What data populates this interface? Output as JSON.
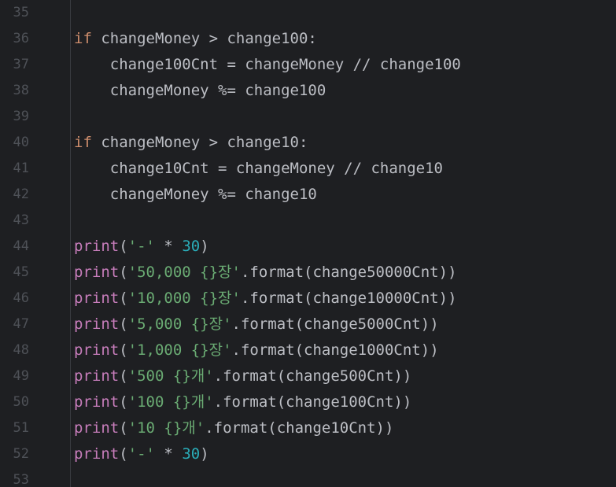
{
  "colors": {
    "background": "#1e1f22",
    "line_number": "#4e5157",
    "keyword": "#cf8e6d",
    "builtin_function": "#c77dbb",
    "string": "#6aab73",
    "number": "#2aacb8",
    "text": "#bcbec4"
  },
  "lines": [
    {
      "number": "35",
      "tokens": []
    },
    {
      "number": "36",
      "tokens": [
        {
          "t": "kw",
          "v": "if"
        },
        {
          "t": "plain",
          "v": " changeMoney > change100:"
        }
      ]
    },
    {
      "number": "37",
      "tokens": [
        {
          "t": "plain",
          "v": "    change100Cnt = changeMoney // change100"
        }
      ]
    },
    {
      "number": "38",
      "tokens": [
        {
          "t": "plain",
          "v": "    changeMoney %= change100"
        }
      ]
    },
    {
      "number": "39",
      "tokens": []
    },
    {
      "number": "40",
      "tokens": [
        {
          "t": "kw",
          "v": "if"
        },
        {
          "t": "plain",
          "v": " changeMoney > change10:"
        }
      ]
    },
    {
      "number": "41",
      "tokens": [
        {
          "t": "plain",
          "v": "    change10Cnt = changeMoney // change10"
        }
      ]
    },
    {
      "number": "42",
      "tokens": [
        {
          "t": "plain",
          "v": "    changeMoney %= change10"
        }
      ]
    },
    {
      "number": "43",
      "tokens": []
    },
    {
      "number": "44",
      "tokens": [
        {
          "t": "fn",
          "v": "print"
        },
        {
          "t": "plain",
          "v": "("
        },
        {
          "t": "str",
          "v": "'-'"
        },
        {
          "t": "plain",
          "v": " * "
        },
        {
          "t": "num",
          "v": "30"
        },
        {
          "t": "plain",
          "v": ")"
        }
      ]
    },
    {
      "number": "45",
      "tokens": [
        {
          "t": "fn",
          "v": "print"
        },
        {
          "t": "plain",
          "v": "("
        },
        {
          "t": "str",
          "v": "'50,000 {}장'"
        },
        {
          "t": "plain",
          "v": ".format(change50000Cnt))"
        }
      ]
    },
    {
      "number": "46",
      "tokens": [
        {
          "t": "fn",
          "v": "print"
        },
        {
          "t": "plain",
          "v": "("
        },
        {
          "t": "str",
          "v": "'10,000 {}장'"
        },
        {
          "t": "plain",
          "v": ".format(change10000Cnt))"
        }
      ]
    },
    {
      "number": "47",
      "tokens": [
        {
          "t": "fn",
          "v": "print"
        },
        {
          "t": "plain",
          "v": "("
        },
        {
          "t": "str",
          "v": "'5,000 {}장'"
        },
        {
          "t": "plain",
          "v": ".format(change5000Cnt))"
        }
      ]
    },
    {
      "number": "48",
      "tokens": [
        {
          "t": "fn",
          "v": "print"
        },
        {
          "t": "plain",
          "v": "("
        },
        {
          "t": "str",
          "v": "'1,000 {}장'"
        },
        {
          "t": "plain",
          "v": ".format(change1000Cnt))"
        }
      ]
    },
    {
      "number": "49",
      "tokens": [
        {
          "t": "fn",
          "v": "print"
        },
        {
          "t": "plain",
          "v": "("
        },
        {
          "t": "str",
          "v": "'500 {}개'"
        },
        {
          "t": "plain",
          "v": ".format(change500Cnt))"
        }
      ]
    },
    {
      "number": "50",
      "tokens": [
        {
          "t": "fn",
          "v": "print"
        },
        {
          "t": "plain",
          "v": "("
        },
        {
          "t": "str",
          "v": "'100 {}개'"
        },
        {
          "t": "plain",
          "v": ".format(change100Cnt))"
        }
      ]
    },
    {
      "number": "51",
      "tokens": [
        {
          "t": "fn",
          "v": "print"
        },
        {
          "t": "plain",
          "v": "("
        },
        {
          "t": "str",
          "v": "'10 {}개'"
        },
        {
          "t": "plain",
          "v": ".format(change10Cnt))"
        }
      ]
    },
    {
      "number": "52",
      "tokens": [
        {
          "t": "fn",
          "v": "print"
        },
        {
          "t": "plain",
          "v": "("
        },
        {
          "t": "str",
          "v": "'-'"
        },
        {
          "t": "plain",
          "v": " * "
        },
        {
          "t": "num",
          "v": "30"
        },
        {
          "t": "plain",
          "v": ")"
        }
      ]
    },
    {
      "number": "53",
      "tokens": []
    }
  ]
}
